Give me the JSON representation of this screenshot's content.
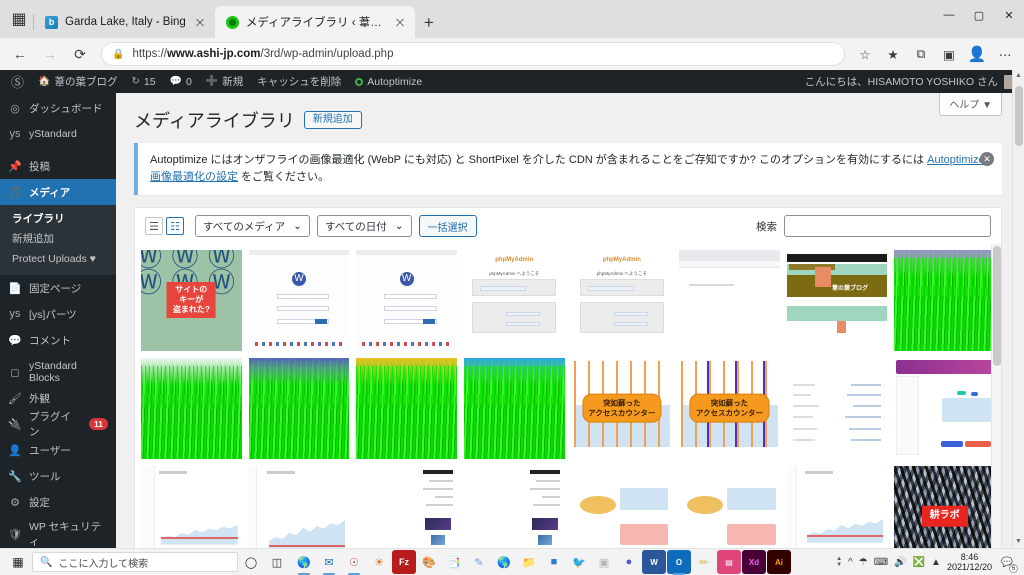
{
  "browser": {
    "tabs": [
      {
        "title": "Garda Lake, Italy - Bing",
        "favicon": "bing-icon",
        "active": false
      },
      {
        "title": "メディアライブラリ ‹ 葦の葉ブログ ー \\",
        "favicon": "wordpress-icon",
        "active": true
      }
    ],
    "new_tab_label": "+",
    "window_controls": {
      "minimize": "—",
      "maximize": "▢",
      "close": "✕"
    },
    "nav": {
      "back": "←",
      "forward": "→",
      "reload": "⟳"
    },
    "address": {
      "lock_icon": "lock-icon",
      "url_prefix": "https://",
      "url_domain": "www.ashi-jp.com",
      "url_path": "/3rd/wp-admin/upload.php",
      "full_url": "https://www.ashi-jp.com/3rd/wp-admin/upload.php"
    },
    "toolbar_icons": [
      "favorite-star-icon",
      "favorites-list-icon",
      "collections-icon",
      "screenshot-icon",
      "profile-icon",
      "settings-more-icon"
    ],
    "tab_strip_icon": "tab-actions-icon"
  },
  "adminbar": {
    "logo": "wordpress-logo-icon",
    "site_name": "葦の葉ブログ",
    "site_icon": "home-icon",
    "updates_icon": "updates-icon",
    "updates_count": "15",
    "comments_icon": "comment-icon",
    "comments_count": "0",
    "new_icon": "plus-icon",
    "new_label": "新規",
    "cache_label": "キャッシュを削除",
    "autoptimize_label": "Autoptimize",
    "autoptimize_icon": "circle-icon",
    "greeting": "こんにちは、HISAMOTO YOSHIKO さん",
    "avatar": "user-avatar"
  },
  "sidebar": {
    "items": [
      {
        "icon": "dashboard-icon",
        "label": "ダッシュボード",
        "current": false
      },
      {
        "icon": "ystandard-icon",
        "label": "yStandard",
        "current": false
      },
      {
        "icon": "pin-icon",
        "label": "投稿",
        "current": false
      },
      {
        "icon": "media-icon",
        "label": "メディア",
        "current": true
      },
      {
        "icon": "page-icon",
        "label": "固定ページ",
        "current": false
      },
      {
        "icon": "ystandard-icon",
        "label": "[ys]パーツ",
        "current": false
      },
      {
        "icon": "comment-icon",
        "label": "コメント",
        "current": false
      },
      {
        "icon": "block-icon",
        "label": "yStandard Blocks",
        "current": false
      },
      {
        "icon": "appearance-icon",
        "label": "外観",
        "current": false
      },
      {
        "icon": "plugin-icon",
        "label": "プラグイン",
        "current": false,
        "badge": "11"
      },
      {
        "icon": "users-icon",
        "label": "ユーザー",
        "current": false
      },
      {
        "icon": "tools-icon",
        "label": "ツール",
        "current": false
      },
      {
        "icon": "settings-icon",
        "label": "設定",
        "current": false
      },
      {
        "icon": "shield-icon",
        "label": "WP セキュリティ",
        "current": false
      }
    ],
    "submenu": [
      {
        "label": "ライブラリ",
        "current": true
      },
      {
        "label": "新規追加",
        "current": false
      },
      {
        "label": "Protect Uploads",
        "current": false,
        "icon": "shield-icon"
      }
    ]
  },
  "main": {
    "help_tab": "ヘルプ ▼",
    "page_title": "メディアライブラリ",
    "add_new_button": "新規追加",
    "notice": {
      "text_part1": "Autoptimize にはオンザフライの画像最適化 (WebP にも対応) と ShortPixel を介した CDN が含まれることをご存知ですか? このオプションを有効にするには ",
      "link_text": "Autoptimize 画像最適化の設定",
      "text_part2": " をご覧ください。",
      "dismiss_icon": "close-icon"
    },
    "toolbar": {
      "list_view_icon": "list-view-icon",
      "grid_view_icon": "grid-view-icon",
      "media_filter": "すべてのメディア",
      "date_filter": "すべての日付",
      "bulk_select_button": "一括選択",
      "chevron": "⌄"
    },
    "search": {
      "label": "検索",
      "value": "",
      "placeholder": ""
    },
    "thumbnails": [
      {
        "kind": "wp-pattern",
        "caption": "サイトの\nキーが\n盗まれた?",
        "selected": true
      },
      {
        "kind": "wp-login-screen",
        "caption": ""
      },
      {
        "kind": "wp-login-screen",
        "caption": ""
      },
      {
        "kind": "phpmyadmin",
        "caption": "phpMyAdmin へようこそ"
      },
      {
        "kind": "phpmyadmin",
        "caption": "phpMyAdmin へようこそ"
      },
      {
        "kind": "browser-blank",
        "caption": ""
      },
      {
        "kind": "blog-page",
        "caption": "葦の葉ブログ"
      },
      {
        "kind": "grass-purple",
        "caption": ""
      },
      {
        "kind": "grass-white",
        "caption": ""
      },
      {
        "kind": "grass-blue",
        "caption": ""
      },
      {
        "kind": "grass-yellow",
        "caption": ""
      },
      {
        "kind": "grass-cyan",
        "caption": ""
      },
      {
        "kind": "counter-orange",
        "caption": "突如蘇った\nアクセスカウンター"
      },
      {
        "kind": "counter-blue",
        "caption": "突如蘇った\nアクセスカウンター"
      },
      {
        "kind": "list-page",
        "caption": ""
      },
      {
        "kind": "dashboard-purple",
        "caption": ""
      },
      {
        "kind": "analytics-small",
        "caption": ""
      },
      {
        "kind": "analytics-large",
        "caption": ""
      },
      {
        "kind": "document-page",
        "caption": ""
      },
      {
        "kind": "document-page",
        "caption": ""
      },
      {
        "kind": "document-page",
        "caption": ""
      },
      {
        "kind": "document-page",
        "caption": ""
      },
      {
        "kind": "document-page",
        "caption": ""
      },
      {
        "kind": "kou-lab",
        "caption": "耕ラボ"
      }
    ]
  },
  "taskbar": {
    "start_icon": "windows-start-icon",
    "search_icon": "search-icon",
    "search_placeholder": "ここに入力して検索",
    "cortana_icon": "cortana-icon",
    "taskview_icon": "task-view-icon",
    "apps": [
      {
        "icon": "edge-icon",
        "open": true
      },
      {
        "icon": "mail-icon",
        "open": true
      },
      {
        "icon": "chrome-icon",
        "open": true
      },
      {
        "icon": "firefox-icon",
        "open": false
      },
      {
        "icon": "filezilla-icon",
        "open": false
      },
      {
        "icon": "paint-icon",
        "open": false
      },
      {
        "icon": "notes-icon",
        "open": false
      },
      {
        "icon": "sticky-notes-icon",
        "open": false
      },
      {
        "icon": "maps-icon",
        "open": false
      },
      {
        "icon": "folder-icon",
        "open": false
      },
      {
        "icon": "onedrive-icon",
        "open": false
      },
      {
        "icon": "bird-icon",
        "open": false
      },
      {
        "icon": "powerpoint-icon",
        "open": false
      },
      {
        "icon": "teams-icon",
        "open": false
      },
      {
        "icon": "word-icon",
        "open": false
      },
      {
        "icon": "outlook-icon",
        "open": true
      },
      {
        "icon": "highlighter-icon",
        "open": false
      },
      {
        "icon": "capture-icon",
        "open": false
      },
      {
        "icon": "adobe-xd-icon",
        "open": false
      },
      {
        "icon": "adobe-illustrator-icon",
        "open": false
      }
    ],
    "tray": {
      "chevron_icon": "show-hidden-icon",
      "wifi_icon": "wifi-icon",
      "ime_icon": "ime-icon",
      "volume_icon": "volume-icon",
      "close_icon": "dismiss-icon",
      "onedrive_icon": "app-icon",
      "time": "8:46",
      "date": "2021/12/20",
      "notification_icon": "notification-icon",
      "notification_count": "6"
    }
  },
  "colors": {
    "wp_blue": "#2271b1",
    "wp_dark": "#1d2327",
    "wp_submenu": "#2c3338",
    "notice_border": "#72aee6",
    "badge_red": "#d63638",
    "page_bg": "#f0f0f1"
  }
}
